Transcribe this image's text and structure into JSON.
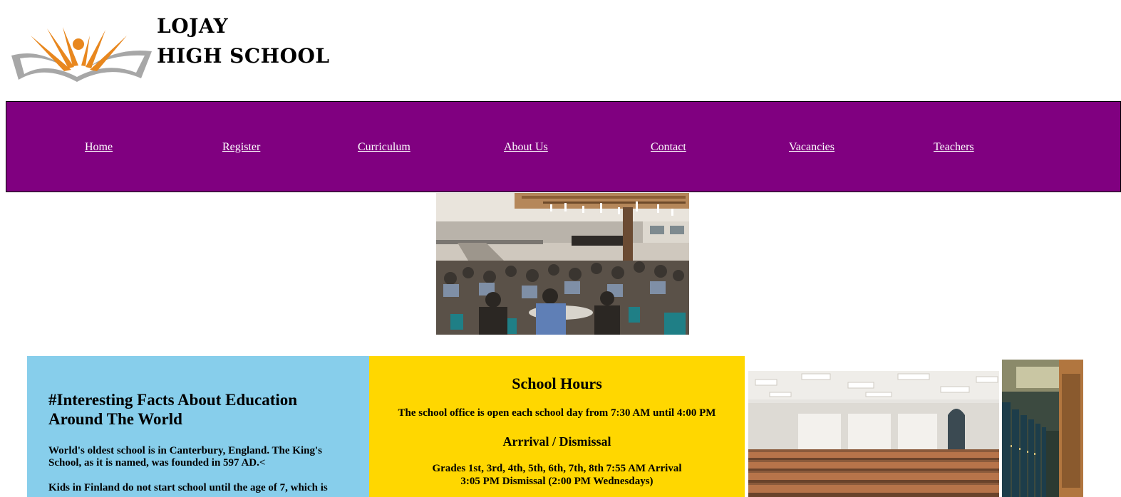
{
  "logo": {
    "line1": "LOJAY",
    "line2": "HIGH SCHOOL",
    "colors": {
      "orange": "#e8871e",
      "grey": "#a7a7a7"
    }
  },
  "nav": {
    "items": [
      {
        "label": "Home"
      },
      {
        "label": "Register"
      },
      {
        "label": "Curriculum"
      },
      {
        "label": "About Us"
      },
      {
        "label": "Contact"
      },
      {
        "label": "Vacancies"
      },
      {
        "label": "Teachers"
      }
    ],
    "background": "#800080"
  },
  "facts": {
    "title": "#Interesting Facts About Education Around The World",
    "paragraphs": [
      "World's oldest school is in Canterbury, England. The King's School, as it is named, was founded in 597 AD.<",
      "Kids in Finland do not start school until the age of 7, which is"
    ],
    "background": "#87ceeb"
  },
  "hours": {
    "title": "School Hours",
    "office": "The school office is open each school day from 7:30 AM until 4:00 PM",
    "subtitle": "Arrrival / Dismissal",
    "grades_line1": "Grades 1st, 3rd, 4th, 5th, 6th, 7th, 8th 7:55 AM Arrival",
    "grades_line2": "3:05 PM Dismissal (2:00 PM Wednesdays)",
    "background": "#ffd700"
  },
  "images": {
    "hero": "cafeteria-photo",
    "lecture": "lecture-hall-photo",
    "hallway": "locker-hallway-photo"
  }
}
